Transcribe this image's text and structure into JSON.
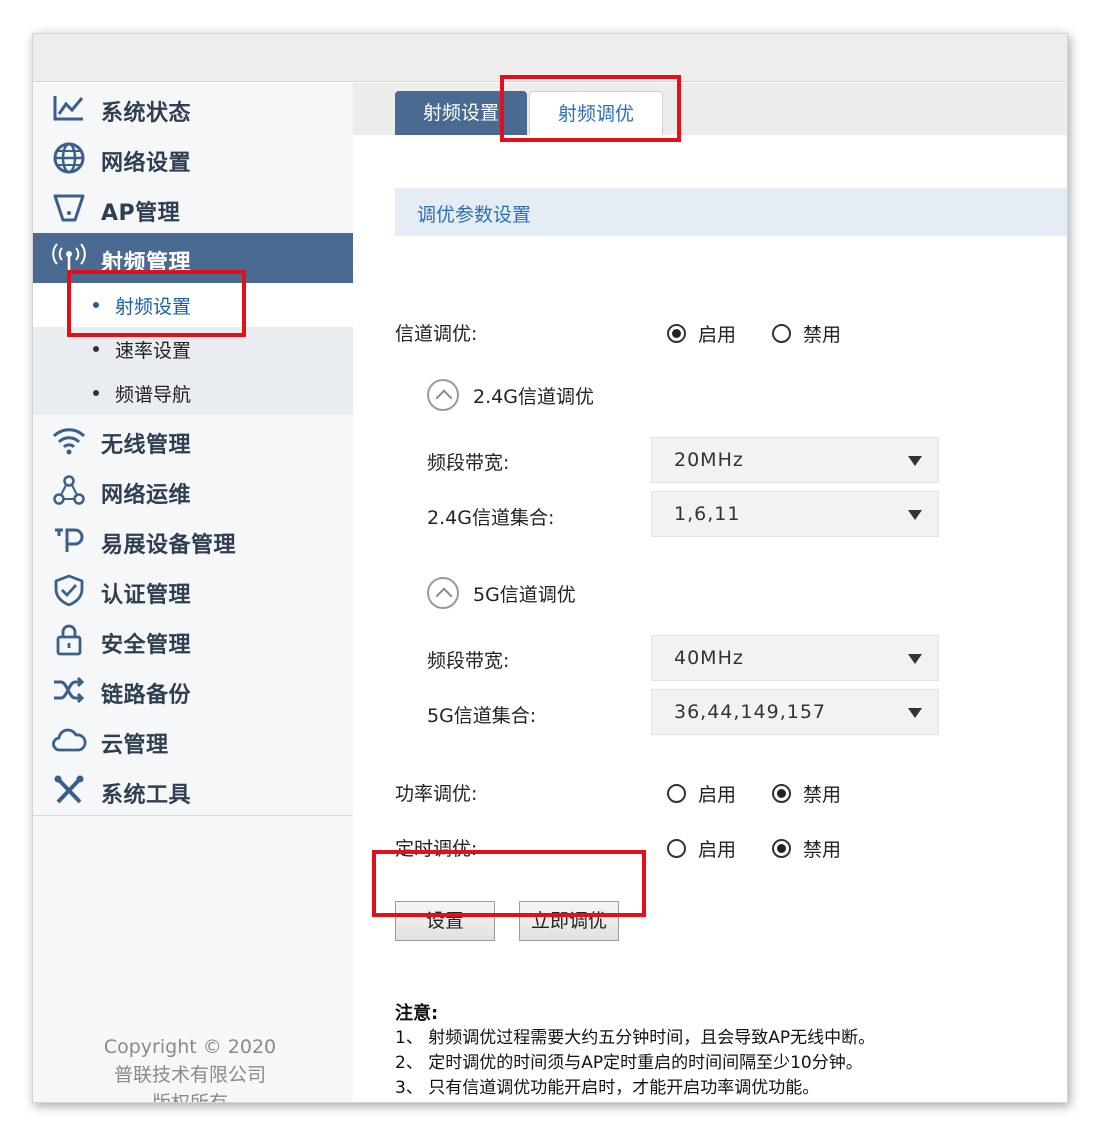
{
  "sidebar": {
    "items": [
      {
        "label": "系统状态",
        "icon": "line-chart-icon"
      },
      {
        "label": "网络设置",
        "icon": "globe-icon"
      },
      {
        "label": "AP管理",
        "icon": "ap-device-icon"
      },
      {
        "label": "射频管理",
        "icon": "radio-signal-icon"
      },
      {
        "label": "无线管理",
        "icon": "wifi-icon"
      },
      {
        "label": "网络运维",
        "icon": "network-nodes-icon"
      },
      {
        "label": "易展设备管理",
        "icon": "tp-logo-icon"
      },
      {
        "label": "认证管理",
        "icon": "shield-check-icon"
      },
      {
        "label": "安全管理",
        "icon": "lock-icon"
      },
      {
        "label": "链路备份",
        "icon": "shuffle-icon"
      },
      {
        "label": "云管理",
        "icon": "cloud-icon"
      },
      {
        "label": "系统工具",
        "icon": "tools-icon"
      }
    ],
    "sub_items": [
      {
        "label": "射频设置"
      },
      {
        "label": "速率设置"
      },
      {
        "label": "频谱导航"
      }
    ],
    "copyright": [
      "Copyright © 2020",
      "普联技术有限公司",
      "版权所有"
    ]
  },
  "tabs": [
    {
      "label": "射频设置"
    },
    {
      "label": "射频调优"
    }
  ],
  "section": {
    "title": "调优参数设置"
  },
  "form": {
    "channel_tuning": {
      "label": "信道调优:",
      "enable": "启用",
      "disable": "禁用",
      "selected": "启用"
    },
    "band24": {
      "title": "2.4G信道调优",
      "bandwidth_label": "频段带宽:",
      "bandwidth_value": "20MHz",
      "channels_label": "2.4G信道集合:",
      "channels_value": "1,6,11"
    },
    "band5": {
      "title": "5G信道调优",
      "bandwidth_label": "频段带宽:",
      "bandwidth_value": "40MHz",
      "channels_label": "5G信道集合:",
      "channels_value": "36,44,149,157"
    },
    "power_tuning": {
      "label": "功率调优:",
      "enable": "启用",
      "disable": "禁用",
      "selected": "禁用"
    },
    "timed_tuning": {
      "label": "定时调优:",
      "enable": "启用",
      "disable": "禁用",
      "selected": "禁用"
    }
  },
  "buttons": {
    "save": "设置",
    "tune_now": "立即调优"
  },
  "notes": {
    "title": "注意:",
    "lines": [
      "1、 射频调优过程需要大约五分钟时间，且会导致AP无线中断。",
      "2、 定时调优的时间须与AP定时重启的时间间隔至少10分钟。",
      "3、 只有信道调优功能开启时，才能开启功率调优功能。"
    ]
  },
  "colors": {
    "accent": "#4b6a91",
    "link": "#2a6fba",
    "highlight": "#e3101a"
  }
}
